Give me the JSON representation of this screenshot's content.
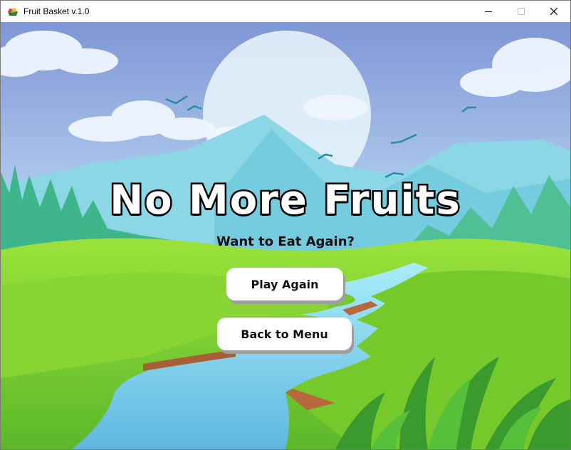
{
  "window": {
    "title": "Fruit Basket v.1.0",
    "controls": [
      "minimize",
      "maximize",
      "close"
    ]
  },
  "game_over": {
    "heading": "No More Fruits",
    "subheading": "Want to Eat Again?",
    "play_again_label": "Play Again",
    "back_to_menu_label": "Back to Menu"
  },
  "colors": {
    "sky_top": "#7f96d6",
    "sky_bottom": "#c9f0f5",
    "grass": "#7ed321",
    "river": "#7fd7ec",
    "button_bg": "#ffffff",
    "heading_text": "#ffffff",
    "heading_outline": "#000000"
  }
}
